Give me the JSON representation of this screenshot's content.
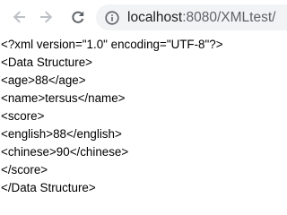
{
  "browser": {
    "url_host": "localhost",
    "url_rest": ":8080/XMLtest/",
    "icons": {
      "back": "arrow-left-icon",
      "forward": "arrow-right-icon",
      "reload": "reload-icon",
      "site_info": "info-circle-icon"
    },
    "colors": {
      "icon_active": "#5f6368",
      "icon_disabled": "#bdc1c6",
      "omnibox_bg": "#f1f3f4"
    }
  },
  "content": {
    "lines": [
      "<?xml version=\"1.0\" encoding=\"UTF-8\"?>",
      "<Data Structure>",
      "<age>88</age>",
      "<name>tersus</name>",
      "<score>",
      "<english>88</english>",
      "<chinese>90</chinese>",
      "</score>",
      "</Data Structure>"
    ]
  }
}
